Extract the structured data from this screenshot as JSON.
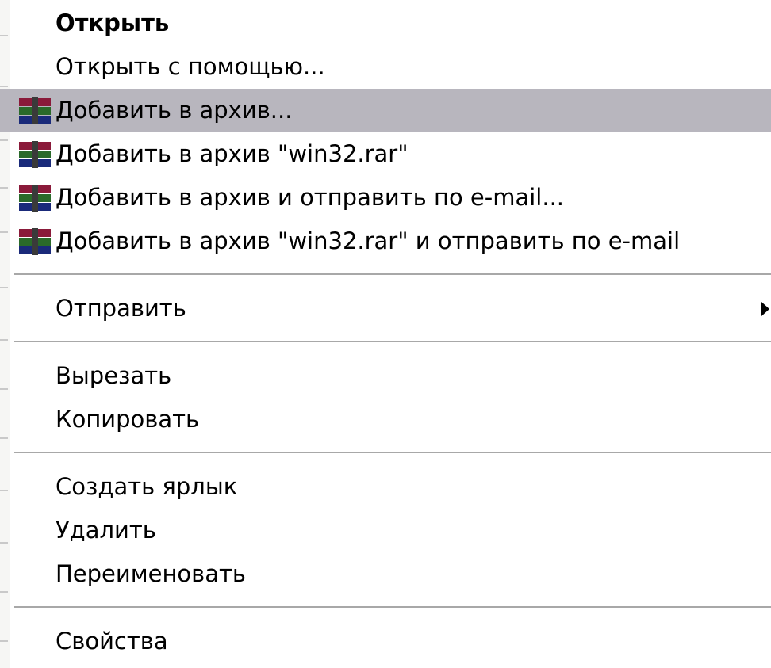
{
  "menu": {
    "items": [
      {
        "label": "Открыть"
      },
      {
        "label": "Открыть с помощью..."
      },
      {
        "label": "Добавить в архив...",
        "icon": "winrar-archive-icon"
      },
      {
        "label": "Добавить в архив \"win32.rar\"",
        "icon": "winrar-archive-icon"
      },
      {
        "label": "Добавить в архив и отправить по e-mail...",
        "icon": "winrar-archive-icon"
      },
      {
        "label": "Добавить в архив \"win32.rar\" и отправить по e-mail",
        "icon": "winrar-archive-icon"
      },
      {
        "label": "Отправить",
        "submenu_icon": "chevron-right-icon"
      },
      {
        "label": "Вырезать"
      },
      {
        "label": "Копировать"
      },
      {
        "label": "Создать ярлык"
      },
      {
        "label": "Удалить"
      },
      {
        "label": "Переименовать"
      },
      {
        "label": "Свойства"
      }
    ],
    "highlight_color": "#b8b6be"
  }
}
